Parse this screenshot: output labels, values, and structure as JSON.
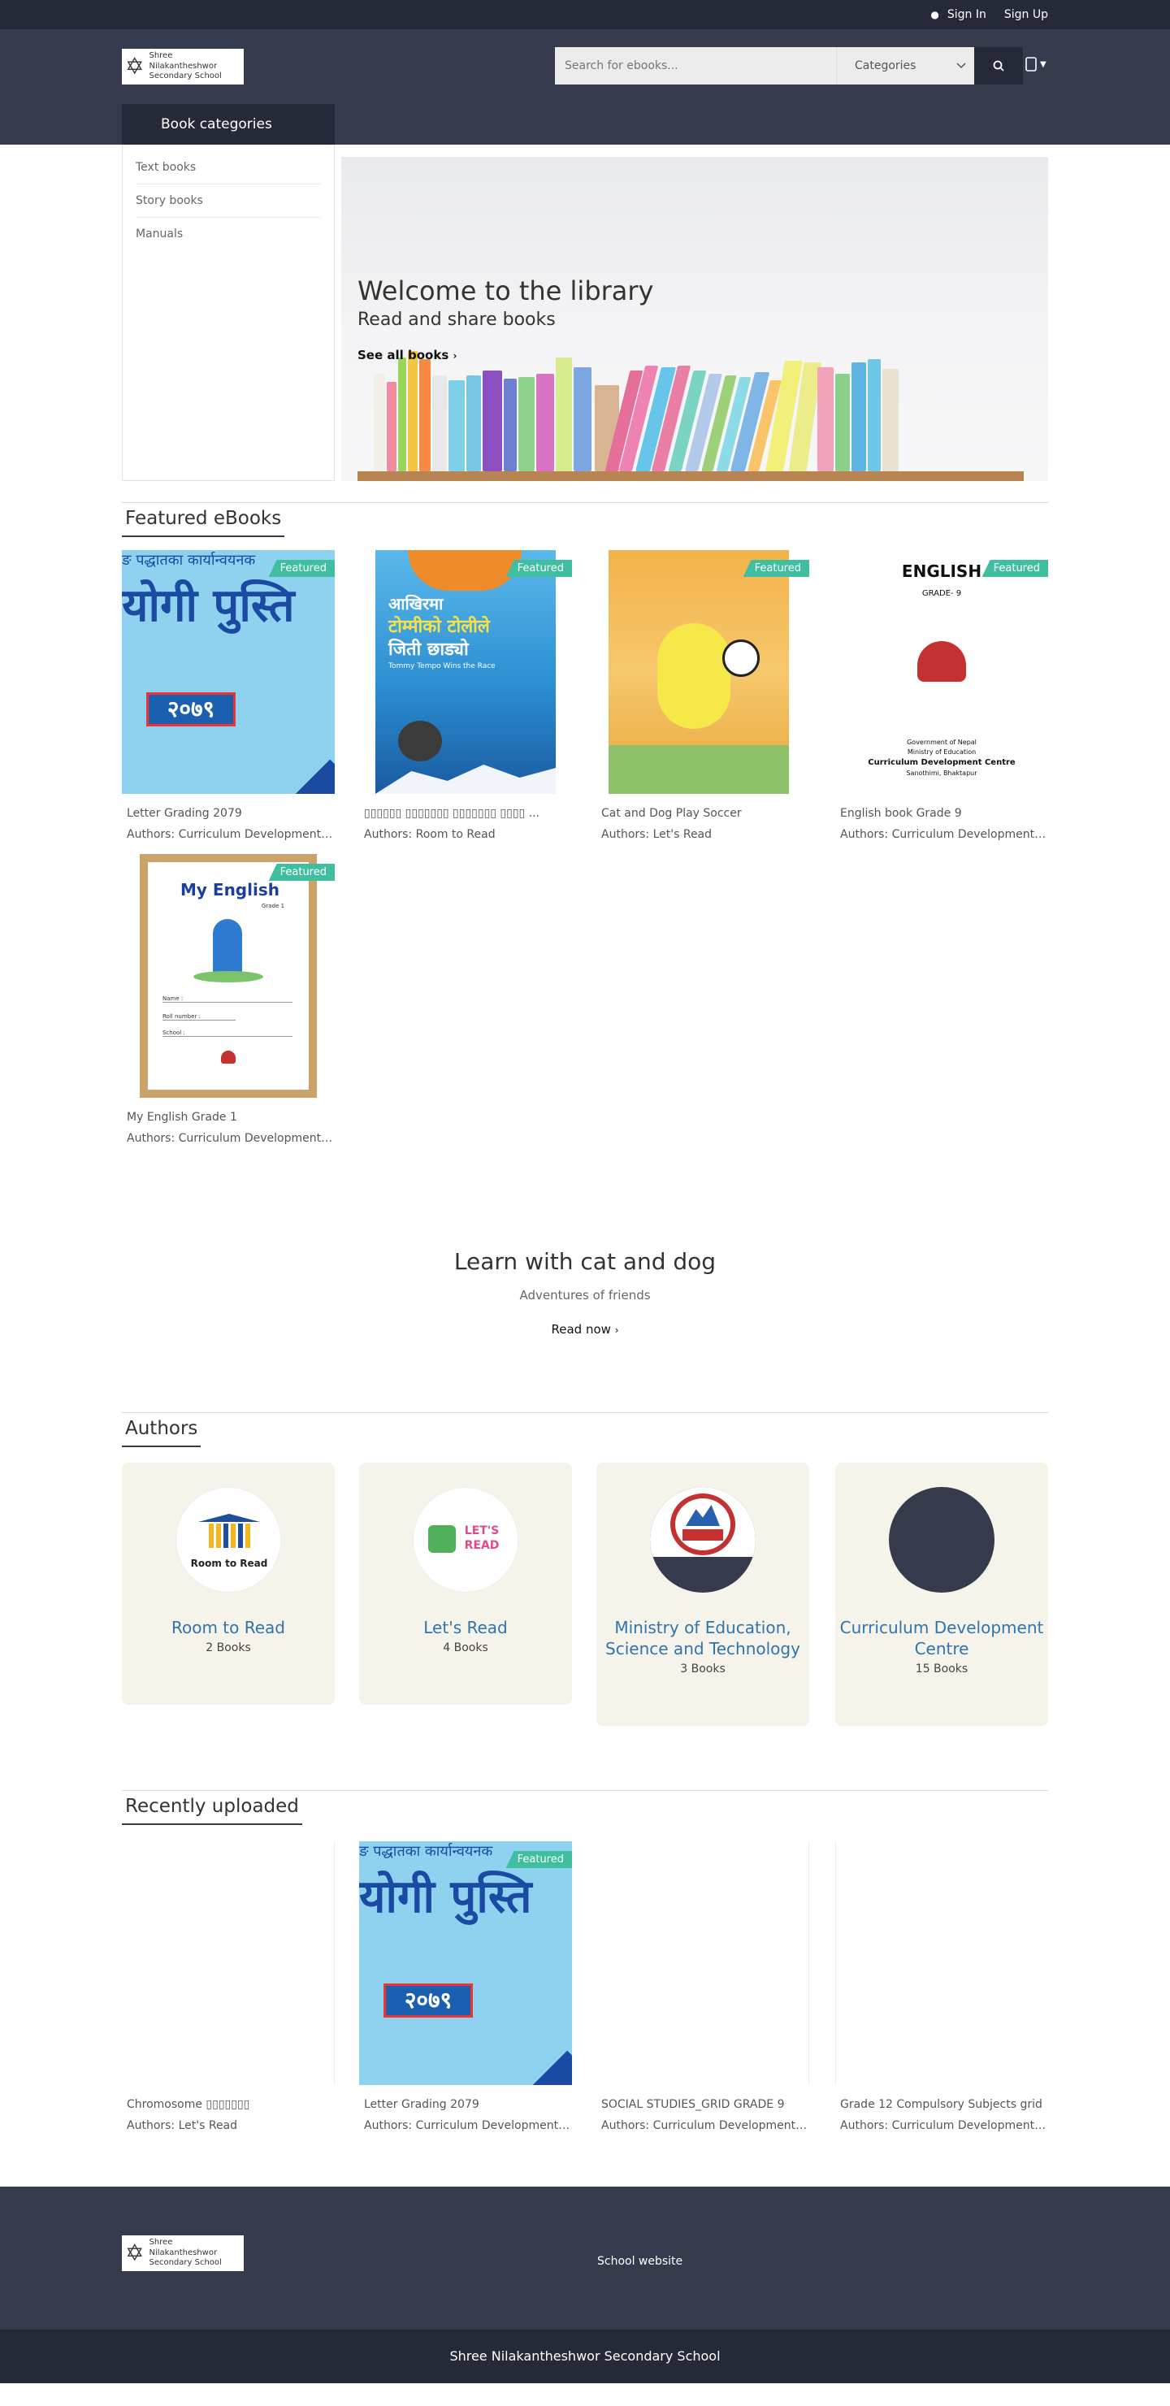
{
  "topbar": {
    "signin": "Sign In",
    "signup": "Sign Up"
  },
  "brand": {
    "name_line1": "Shree Nilakantheshwor",
    "name_line2": "Secondary School"
  },
  "search": {
    "placeholder": "Search for ebooks...",
    "category": "Categories"
  },
  "categories": {
    "heading": "Book categories",
    "items": [
      {
        "label": "Text books"
      },
      {
        "label": "Story books"
      },
      {
        "label": "Manuals"
      }
    ]
  },
  "banner": {
    "title": "Welcome to the library",
    "subtitle": "Read and share books",
    "link": "See all books"
  },
  "featured": {
    "heading": "Featured eBooks",
    "badge": "Featured",
    "books": [
      {
        "title": "Letter Grading 2079",
        "author": "Authors: Curriculum Development ..."
      },
      {
        "title": "▯▯▯▯▯▯ ▯▯▯▯▯▯▯ ▯▯▯▯▯▯▯ ▯▯▯▯ ...",
        "author": "Authors: Room to Read"
      },
      {
        "title": "Cat and Dog Play Soccer",
        "author": "Authors: Let's Read"
      },
      {
        "title": "English book Grade 9",
        "author": "Authors: Curriculum Development ..."
      },
      {
        "title": "My English Grade 1",
        "author": "Authors: Curriculum Development ..."
      }
    ]
  },
  "covers": {
    "grading_top": "ङ पद्धातका कार्यान्वयनक",
    "grading_big": "योगी पुस्ति",
    "grading_year": "२०७९",
    "para_l1": "आखिरमा",
    "para_l2": "टोम्मीको टोलीले",
    "para_l3": "जिती छाड्यो",
    "para_sub": "Tommy Tempo Wins the Race",
    "eng9_title": "ENGLISH",
    "eng9_grade": "GRADE- 9",
    "eng9_gov": "Government of Nepal",
    "eng9_min": "Ministry of Education",
    "eng9_cdc": "Curriculum Development Centre",
    "eng9_place": "Sanothimi, Bhaktapur",
    "eng1_title": "My English",
    "eng1_grade": "Grade 1",
    "eng1_name": "Name :",
    "eng1_roll": "Roll number :",
    "eng1_school": "School :"
  },
  "promo": {
    "title": "Learn with cat and dog",
    "subtitle": "Adventures of friends",
    "link": "Read now"
  },
  "authors": {
    "heading": "Authors",
    "items": [
      {
        "name": "Room to Read",
        "count": "2 Books",
        "logo_text": "Room to Read"
      },
      {
        "name": "Let's Read",
        "count": "4 Books",
        "logo_text": "LET'S READ"
      },
      {
        "name": "Ministry of Education, Science and Technology",
        "count": "3 Books"
      },
      {
        "name": "Curriculum Development Centre",
        "count": "15 Books"
      }
    ]
  },
  "recent": {
    "heading": "Recently uploaded",
    "badge": "Featured",
    "books": [
      {
        "title": "Chromosome ▯▯▯▯▯▯▯",
        "author": "Authors: Let's Read"
      },
      {
        "title": "Letter Grading 2079",
        "author": "Authors: Curriculum Development ..."
      },
      {
        "title": "SOCIAL STUDIES_GRID GRADE 9",
        "author": "Authors: Curriculum Development ..."
      },
      {
        "title": "Grade 12 Compulsory Subjects grid",
        "author": "Authors: Curriculum Development ..."
      }
    ]
  },
  "footer": {
    "link": "School website",
    "copyright": "Shree Nilakantheshwor Secondary School"
  },
  "colors": {
    "dark": "#262a38",
    "header": "#353a4c",
    "accent_badge": "#3fbf9f",
    "author_link": "#2f74ad",
    "card_bg": "#f6f3ea"
  }
}
